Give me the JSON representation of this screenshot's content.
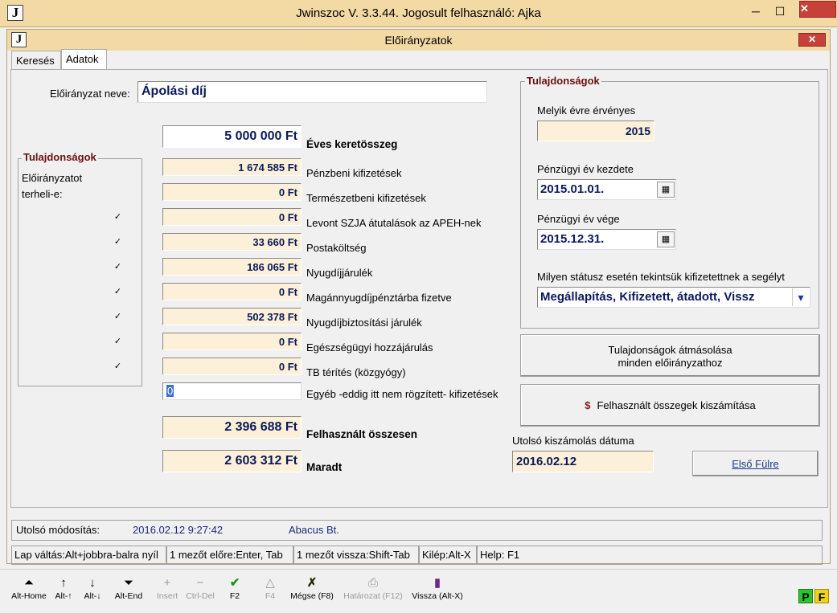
{
  "outer": {
    "title": "Jwinszoc V. 3.3.44.  Jogosult felhasználó: Ajka",
    "icon": "J",
    "minimize": "─",
    "maximize": "☐",
    "close": "✕"
  },
  "inner": {
    "title": "Előirányzatok",
    "icon": "J",
    "close": "✕"
  },
  "tabs": [
    {
      "label": "Keresés"
    },
    {
      "label": "Adatok"
    }
  ],
  "form": {
    "name_label": "Előirányzat neve:",
    "name_value": "Ápolási díj",
    "annual": {
      "value": "5 000 000 Ft",
      "label": "Éves keretösszeg"
    },
    "rows": [
      {
        "value": "1 674 585 Ft",
        "label": "Pénzbeni kifizetések",
        "checked": false
      },
      {
        "value": "0 Ft",
        "label": "Természetbeni kifizetések",
        "checked": false
      },
      {
        "value": "0 Ft",
        "label": "Levont SZJA átutalások az APEH-nek",
        "checked": true
      },
      {
        "value": "33 660 Ft",
        "label": "Postaköltség",
        "checked": true
      },
      {
        "value": "186 065 Ft",
        "label": "Nyugdíjjárulék",
        "checked": true
      },
      {
        "value": "0 Ft",
        "label": "Magánnyugdíjpénztárba fizetve",
        "checked": true
      },
      {
        "value": "502 378 Ft",
        "label": "Nyugdíjbiztosítási járulék",
        "checked": true
      },
      {
        "value": "0 Ft",
        "label": "Egészségügyi hozzájárulás",
        "checked": true
      },
      {
        "value": "0 Ft",
        "label": "TB térítés (közgyógy)",
        "checked": true
      }
    ],
    "other": {
      "value": "0",
      "label": "Egyéb -eddig itt nem rögzített- kifizetések"
    },
    "used_total": {
      "value": "2 396 688 Ft",
      "label": "Felhasznált összesen"
    },
    "remaining": {
      "value": "2 603 312 Ft",
      "label": "Maradt"
    }
  },
  "left_group": {
    "title": "Tulajdonságok",
    "line1": "Előirányzatot",
    "line2": "terheli-e:",
    "check_mark": "✓"
  },
  "right_group": {
    "title": "Tulajdonságok",
    "year_label": "Melyik évre érvényes",
    "year_value": "2015",
    "start_label": "Pénzügyi év kezdete",
    "start_value": "2015.01.01.",
    "end_label": "Pénzügyi év vége",
    "end_value": "2015.12.31.",
    "status_label": "Milyen státusz esetén tekintsük kifizetettnek a segélyt",
    "status_value": "Megállapítás, Kifizetett, átadott, Vissz",
    "calendar_icon": "▦",
    "dropdown_icon": "▾"
  },
  "buttons": {
    "copy_line1": "Tulajdonságok átmásolása",
    "copy_line2": "minden előirányzathoz",
    "calc_icon": "$",
    "calc_label": "Felhasznált összegek kiszámítása",
    "first_tab": "Első Fülre"
  },
  "last_calc": {
    "label": "Utolsó kiszámolás dátuma",
    "value": "2016.02.12"
  },
  "status": {
    "modified_label": "Utolsó módosítás:",
    "modified_value": "2016.02.12 9:27:42",
    "modified_by": "Abacus Bt.",
    "hints": [
      "Lap váltás:Alt+jobbra-balra nyíl",
      "1 mezőt előre:Enter, Tab",
      "1 mezőt vissza:Shift-Tab",
      "Kilép:Alt-X",
      "Help: F1"
    ]
  },
  "toolbar": [
    {
      "label": "Alt-Home",
      "icon": "⏶"
    },
    {
      "label": "Alt-↑",
      "icon": "↑"
    },
    {
      "label": "Alt-↓",
      "icon": "↓"
    },
    {
      "label": "Alt-End",
      "icon": "⏷"
    },
    {
      "label": "Insert",
      "icon": "+"
    },
    {
      "label": "Ctrl-Del",
      "icon": "−"
    },
    {
      "label": "F2",
      "icon": "✔"
    },
    {
      "label": "F4",
      "icon": "△"
    },
    {
      "label": "Mégse (F8)",
      "icon": "✗"
    },
    {
      "label": "Határozat (F12)",
      "icon": "⎙"
    },
    {
      "label": "Vissza (Alt-X)",
      "icon": "▮"
    }
  ],
  "corner": {
    "p": "P",
    "f": "F"
  },
  "colors": {
    "title_bar": "#f3d9a4",
    "field_bg": "#fdf0d8",
    "value_text": "#0a1a5c",
    "group_title": "#6b1010",
    "close_red": "#c7403a"
  }
}
